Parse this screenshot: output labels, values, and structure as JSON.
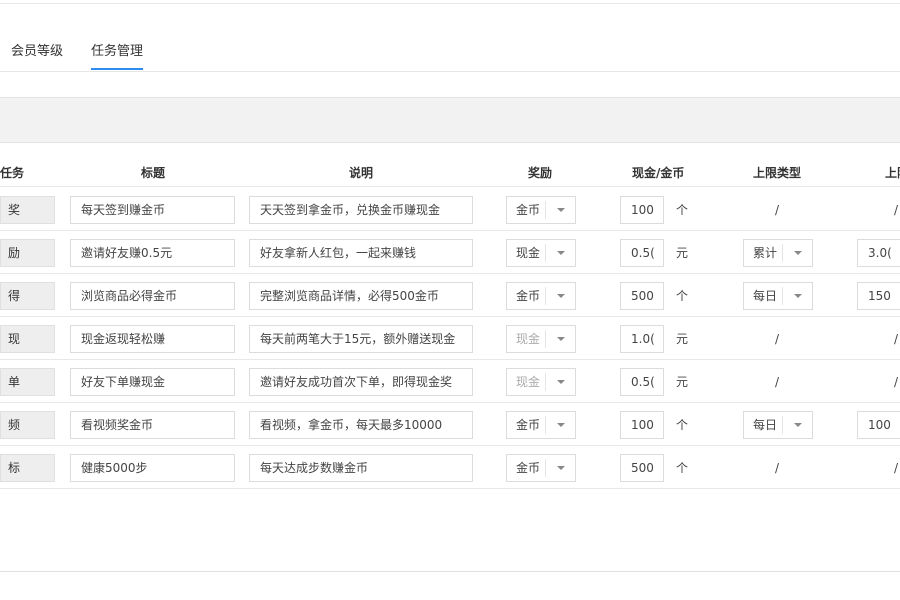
{
  "tabs": [
    {
      "label": "会员等级",
      "active": false
    },
    {
      "label": "任务管理",
      "active": true
    }
  ],
  "colors": {
    "accent": "#2d8cf0"
  },
  "table": {
    "headers": [
      "任务",
      "标题",
      "说明",
      "奖励",
      "现金/金币",
      "上限类型",
      "上限"
    ],
    "rows": [
      {
        "task": "奖",
        "title": "每天签到赚金币",
        "desc": "天天签到拿金币，兑换金币赚现金",
        "reward": "金币",
        "reward_disabled": false,
        "amount": "100",
        "unit": "个",
        "limit_type": "/",
        "limit": "/"
      },
      {
        "task": "励",
        "title": "邀请好友赚0.5元",
        "desc": "好友拿新人红包，一起来赚钱",
        "reward": "现金",
        "reward_disabled": false,
        "amount": "0.5(",
        "unit": "元",
        "limit_type": "累计",
        "limit": "3.0("
      },
      {
        "task": "得",
        "title": "浏览商品必得金币",
        "desc": "完整浏览商品详情，必得500金币",
        "reward": "金币",
        "reward_disabled": false,
        "amount": "500",
        "unit": "个",
        "limit_type": "每日",
        "limit": "150"
      },
      {
        "task": "现",
        "title": "现金返现轻松赚",
        "desc": "每天前两笔大于15元，额外赠送现金",
        "reward": "现金",
        "reward_disabled": true,
        "amount": "1.0(",
        "unit": "元",
        "limit_type": "/",
        "limit": "/"
      },
      {
        "task": "单",
        "title": "好友下单赚现金",
        "desc": "邀请好友成功首次下单，即得现金奖",
        "reward": "现金",
        "reward_disabled": true,
        "amount": "0.5(",
        "unit": "元",
        "limit_type": "/",
        "limit": "/"
      },
      {
        "task": "频",
        "title": "看视频奖金币",
        "desc": "看视频，拿金币，每天最多10000",
        "reward": "金币",
        "reward_disabled": false,
        "amount": "100",
        "unit": "个",
        "limit_type": "每日",
        "limit": "100"
      },
      {
        "task": "标",
        "title": "健康5000步",
        "desc": "每天达成步数赚金币",
        "reward": "金币",
        "reward_disabled": false,
        "amount": "500",
        "unit": "个",
        "limit_type": "/",
        "limit": "/"
      }
    ]
  }
}
